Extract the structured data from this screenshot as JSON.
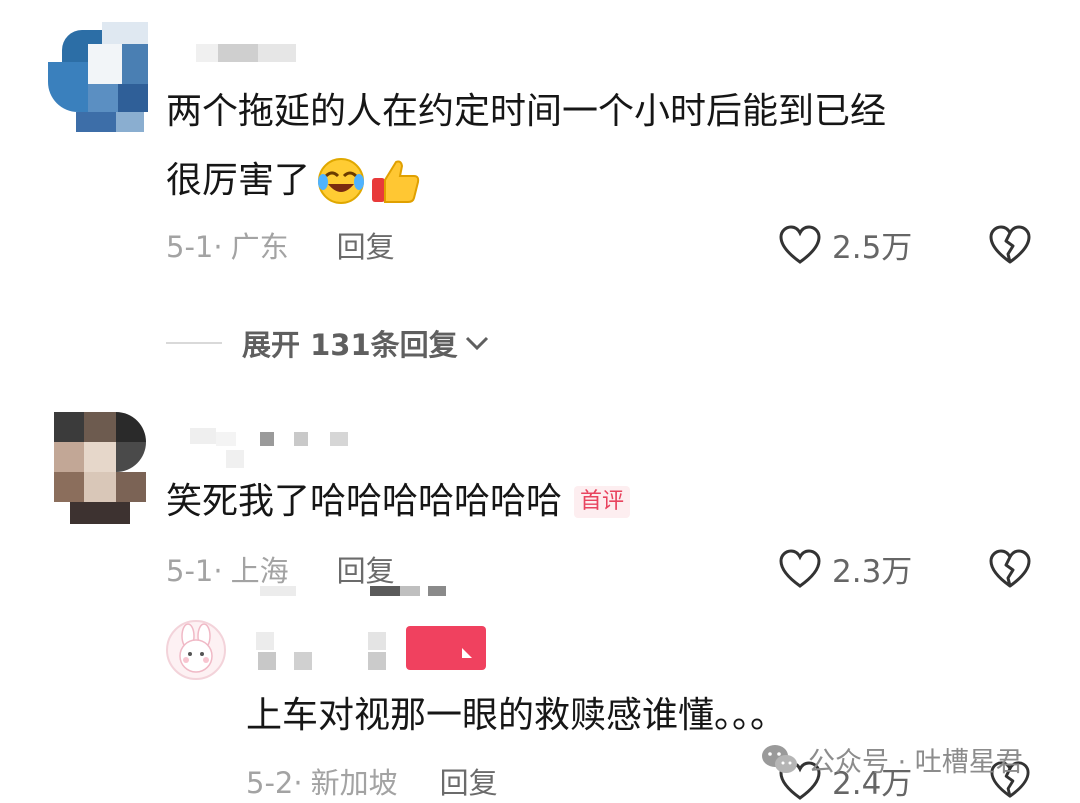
{
  "comments": [
    {
      "text_line1": "两个拖延的人在约定时间一个小时后能到已经",
      "text_line2": "很厉害了",
      "emojis": [
        "laughing-crying-emoji",
        "thumbs-up-emoji"
      ],
      "date": "5-1",
      "location": "广东",
      "reply_label": "回复",
      "likes": "2.5万"
    },
    {
      "text": "笑死我了哈哈哈哈哈哈哈",
      "badge": "首评",
      "date": "5-1",
      "location": "上海",
      "reply_label": "回复",
      "likes": "2.3万"
    }
  ],
  "expand": {
    "label": "展开 131条回复"
  },
  "reply": {
    "text": "上车对视那一眼的救赎感谁懂。。。",
    "date": "5-2",
    "location": "新加坡",
    "reply_label": "回复",
    "likes": "2.4万"
  },
  "watermark": {
    "text": "公众号 · 吐槽星君"
  },
  "colors": {
    "badge": "#e8445f",
    "author_tag": "#f0415f",
    "meta": "#a3a3a3"
  }
}
